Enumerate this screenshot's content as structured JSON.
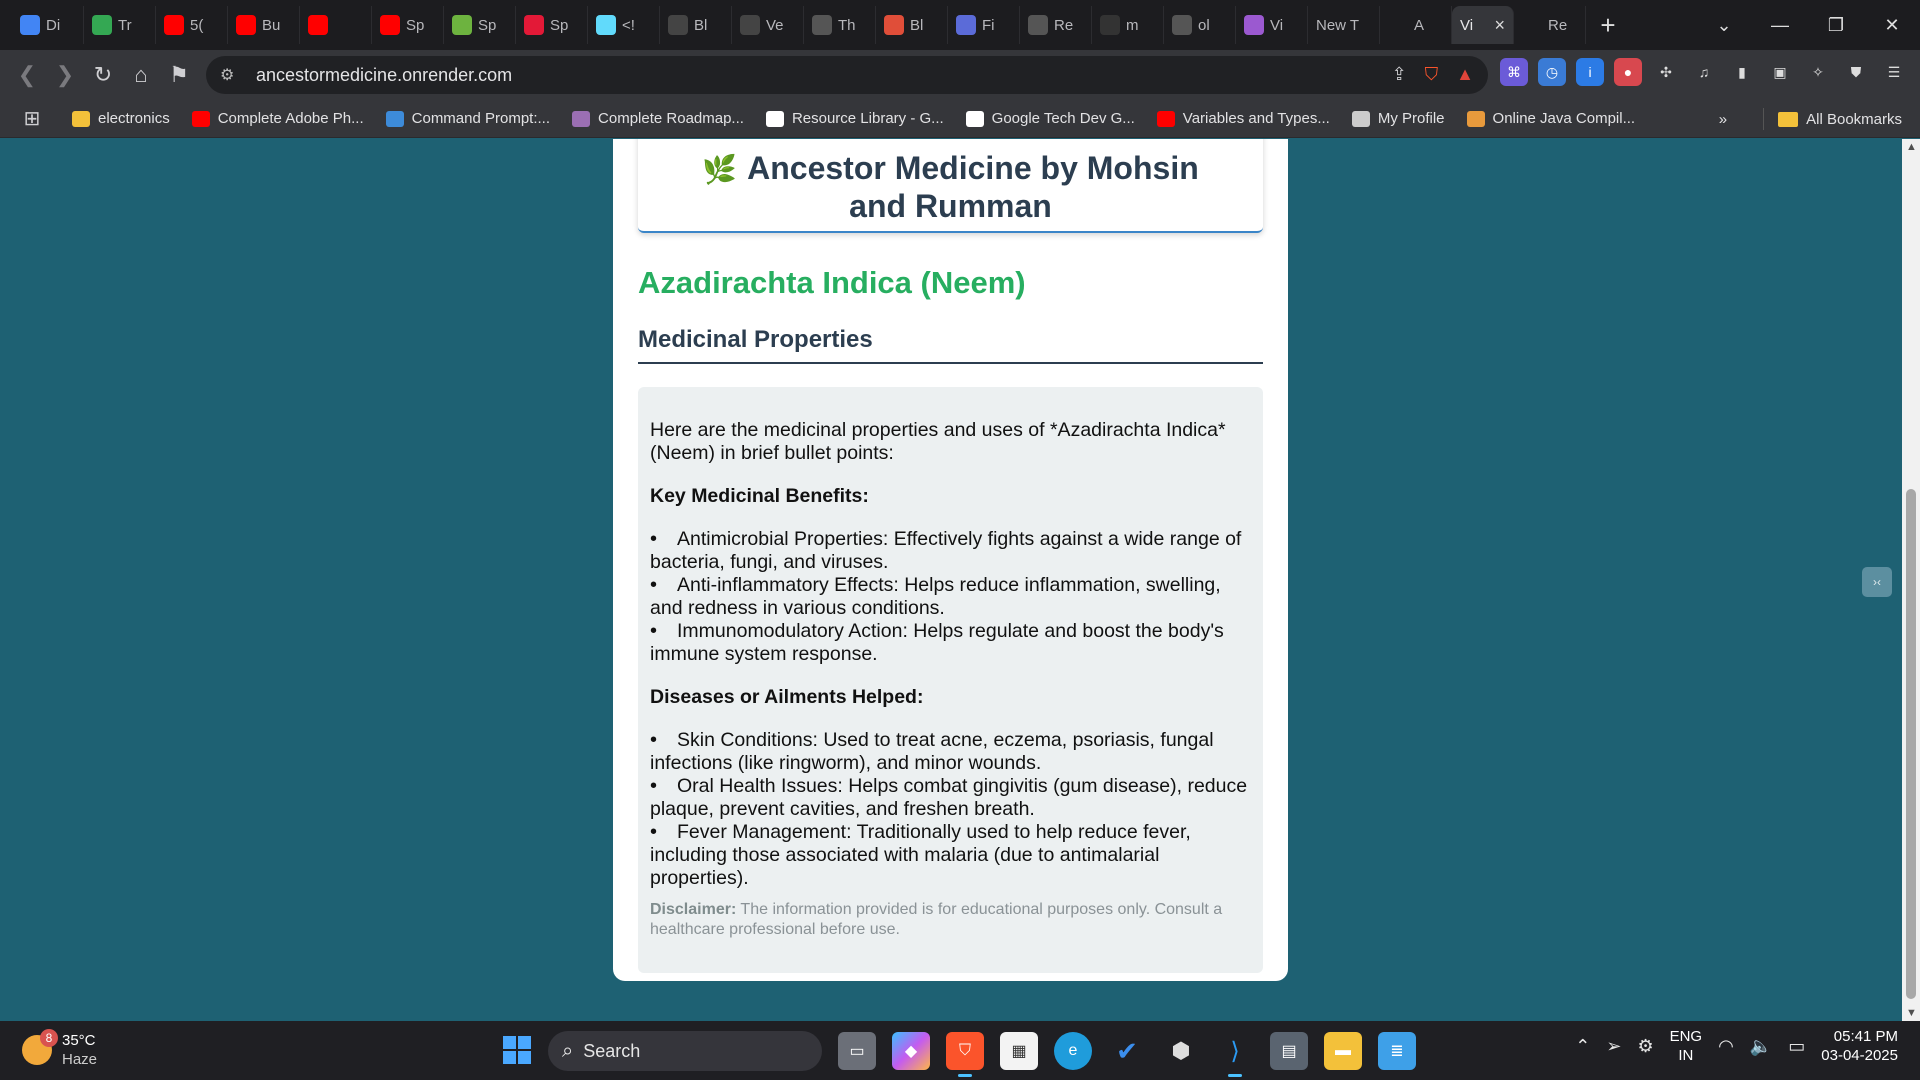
{
  "tabs": [
    {
      "title": "Di",
      "icon": "docs-icon",
      "color": "#4285f4"
    },
    {
      "title": "Tr",
      "icon": "plus-sheet-icon",
      "color": "#34a853"
    },
    {
      "title": "5(",
      "icon": "youtube-icon",
      "color": "#ff0000"
    },
    {
      "title": "Bu",
      "icon": "youtube-icon",
      "color": "#ff0000"
    },
    {
      "title": "",
      "icon": "youtube-icon",
      "color": "#ff0000"
    },
    {
      "title": "Sp",
      "icon": "youtube-icon",
      "color": "#ff0000"
    },
    {
      "title": "Sp",
      "icon": "spring-icon",
      "color": "#6db33f"
    },
    {
      "title": "Sp",
      "icon": "tesla-icon",
      "color": "#e31937"
    },
    {
      "title": "<!",
      "icon": "react-icon",
      "color": "#61dafb"
    },
    {
      "title": "Bl",
      "icon": "tf-icon",
      "color": "#444444"
    },
    {
      "title": "Ve",
      "icon": "game-icon",
      "color": "#444444"
    },
    {
      "title": "Th",
      "icon": "chatgpt-icon",
      "color": "#555555"
    },
    {
      "title": "Bl",
      "icon": "bfe-icon",
      "color": "#e04e39"
    },
    {
      "title": "Fi",
      "icon": "figma-icon",
      "color": "#5b6bd8"
    },
    {
      "title": "Re",
      "icon": "openai-icon",
      "color": "#555555"
    },
    {
      "title": "m",
      "icon": "github-icon",
      "color": "#333333"
    },
    {
      "title": "ol",
      "icon": "globe-icon",
      "color": "#555555"
    },
    {
      "title": "Vi",
      "icon": "vite-icon",
      "color": "#9b59d0"
    },
    {
      "title": "New T",
      "icon": "",
      "color": ""
    },
    {
      "title": "A",
      "icon": "render-icon",
      "color": "#ffffff"
    },
    {
      "title": "Vi",
      "icon": "",
      "color": "",
      "active": true
    },
    {
      "title": "Re",
      "icon": "render-icon",
      "color": "#ffffff"
    }
  ],
  "toolbar": {
    "url": "ancestormedicine.onrender.com"
  },
  "bookmarks": [
    {
      "label": "electronics",
      "icon": "folder-icon",
      "color": "#f3c13a"
    },
    {
      "label": "Complete Adobe Ph...",
      "icon": "youtube-icon",
      "color": "#ff0000"
    },
    {
      "label": "Command Prompt:...",
      "icon": "pin-icon",
      "color": "#3d8bd9"
    },
    {
      "label": "Complete Roadmap...",
      "icon": "avatar-icon",
      "color": "#9b6fb3"
    },
    {
      "label": "Resource Library - G...",
      "icon": "google-icon",
      "color": "#ffffff"
    },
    {
      "label": "Google Tech Dev G...",
      "icon": "google-icon",
      "color": "#ffffff"
    },
    {
      "label": "Variables and Types...",
      "icon": "youtube-icon",
      "color": "#ff0000"
    },
    {
      "label": "My Profile",
      "icon": "document-icon",
      "color": "#cccccc"
    },
    {
      "label": "Online Java Compil...",
      "icon": "sun-icon",
      "color": "#e89a3c"
    }
  ],
  "bookmarks_right": {
    "all_label": "All Bookmarks"
  },
  "page": {
    "site_title": "Ancestor Medicine by Mohsin and Rumman",
    "plant_name": "Azadirachta Indica (Neem)",
    "section_heading": "Medicinal Properties",
    "intro": "Here are the medicinal properties and uses of *Azadirachta Indica* (Neem) in brief bullet points:",
    "benefits_heading": "Key Medicinal Benefits:",
    "benefits": [
      "Antimicrobial Properties: Effectively fights against a wide range of bacteria, fungi, and viruses.",
      "Anti-inflammatory Effects: Helps reduce inflammation, swelling, and redness in various conditions.",
      "Immunomodulatory Action: Helps regulate and boost the body's immune system response."
    ],
    "ailments_heading": "Diseases or Ailments Helped:",
    "ailments": [
      "Skin Conditions: Used to treat acne, eczema, psoriasis, fungal infections (like ringworm), and minor wounds.",
      "Oral Health Issues: Helps combat gingivitis (gum disease), reduce plaque, prevent cavities, and freshen breath.",
      "Fever Management: Traditionally used to help reduce fever, including those associated with malaria (due to antimalarial properties)."
    ],
    "disclaimer_label": "Disclaimer:",
    "disclaimer_text": "The information provided is for educational purposes only. Consult a healthcare professional before use."
  },
  "taskbar": {
    "weather_temp": "35°C",
    "weather_desc": "Haze",
    "weather_badge": "8",
    "search_label": "Search",
    "lang_top": "ENG",
    "lang_bottom": "IN",
    "time": "05:41 PM",
    "date": "03-04-2025"
  },
  "colors": {
    "page_bg": "#1e6173",
    "accent_green": "#27ae60",
    "heading_dark": "#2c3e50",
    "info_bg": "#ecf0f1"
  }
}
